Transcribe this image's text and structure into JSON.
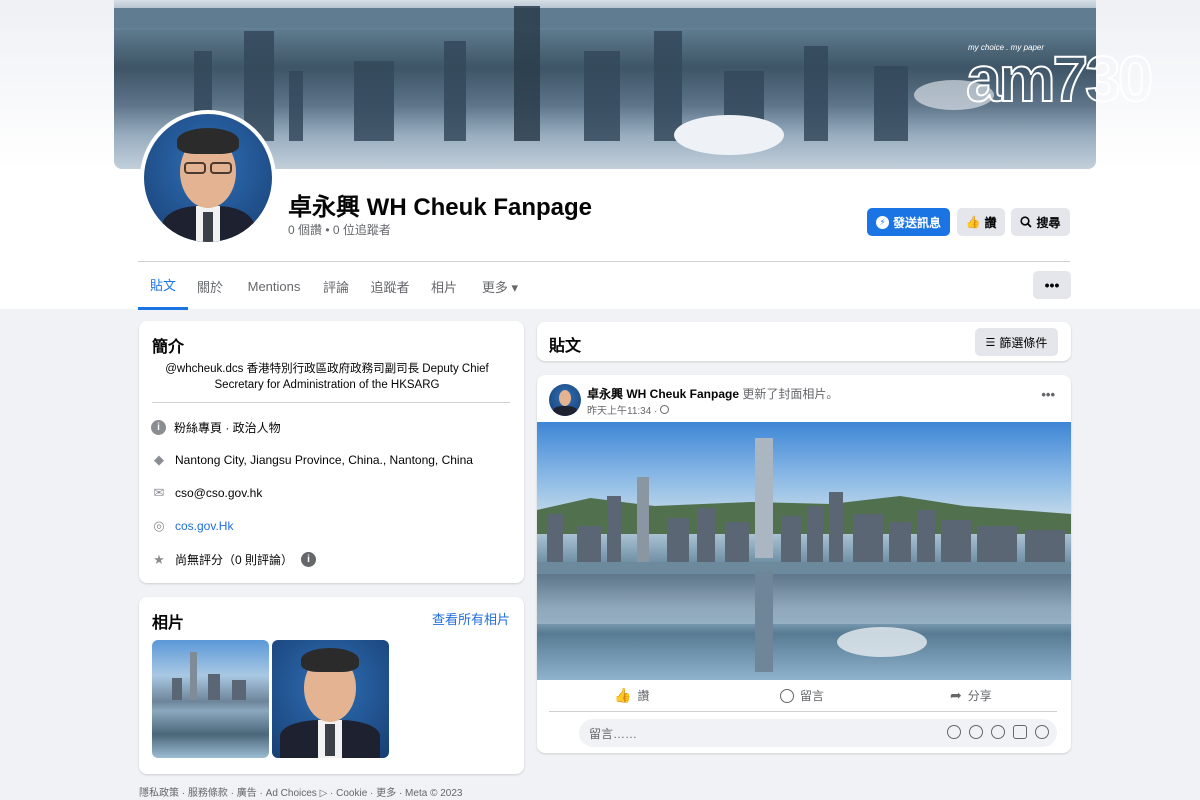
{
  "watermark": {
    "tagline": "my choice . my paper",
    "brand": "am730"
  },
  "profile": {
    "name": "卓永興 WH Cheuk Fanpage",
    "stats": "0 個讚 • 0 位追蹤者"
  },
  "actions": {
    "message_label": "發送訊息",
    "like_label": "讚",
    "search_label": "搜尋"
  },
  "tabs": [
    {
      "label": "貼文"
    },
    {
      "label": "關於"
    },
    {
      "label": "Mentions"
    },
    {
      "label": "評論"
    },
    {
      "label": "追蹤者"
    },
    {
      "label": "相片"
    },
    {
      "label": "更多 ▾"
    }
  ],
  "more_button": "•••",
  "intro": {
    "title": "簡介",
    "description": "@whcheuk.dcs 香港特別行政區政府政務司副司長 Deputy Chief Secretary for Administration of the HKSARG",
    "items": [
      {
        "icon": "info-icon",
        "text": "粉絲專頁 · 政治人物"
      },
      {
        "icon": "location-icon",
        "text": "Nantong City, Jiangsu Province, China., Nantong, China"
      },
      {
        "icon": "email-icon",
        "text": "cso@cso.gov.hk"
      },
      {
        "icon": "globe-icon",
        "text": "cos.gov.Hk"
      },
      {
        "icon": "star-icon",
        "text": "尚無評分（0 則評論）"
      }
    ]
  },
  "photos": {
    "title": "相片",
    "see_all": "查看所有相片"
  },
  "posts": {
    "title": "貼文",
    "filter_label": "篩選條件"
  },
  "post": {
    "author": "卓永興 WH Cheuk Fanpage",
    "action": "更新了封面相片。",
    "time": "昨天上午11:34 ·",
    "menu": "•••",
    "like": "讚",
    "comment": "留言",
    "share": "分享",
    "comment_placeholder": "留言……"
  },
  "footer": "隱私政策 · 服務條款 · 廣告 · Ad Choices ▷ · Cookie · 更多 · Meta © 2023",
  "colors": {
    "accent": "#1b74e4",
    "background": "#f0f2f5"
  }
}
